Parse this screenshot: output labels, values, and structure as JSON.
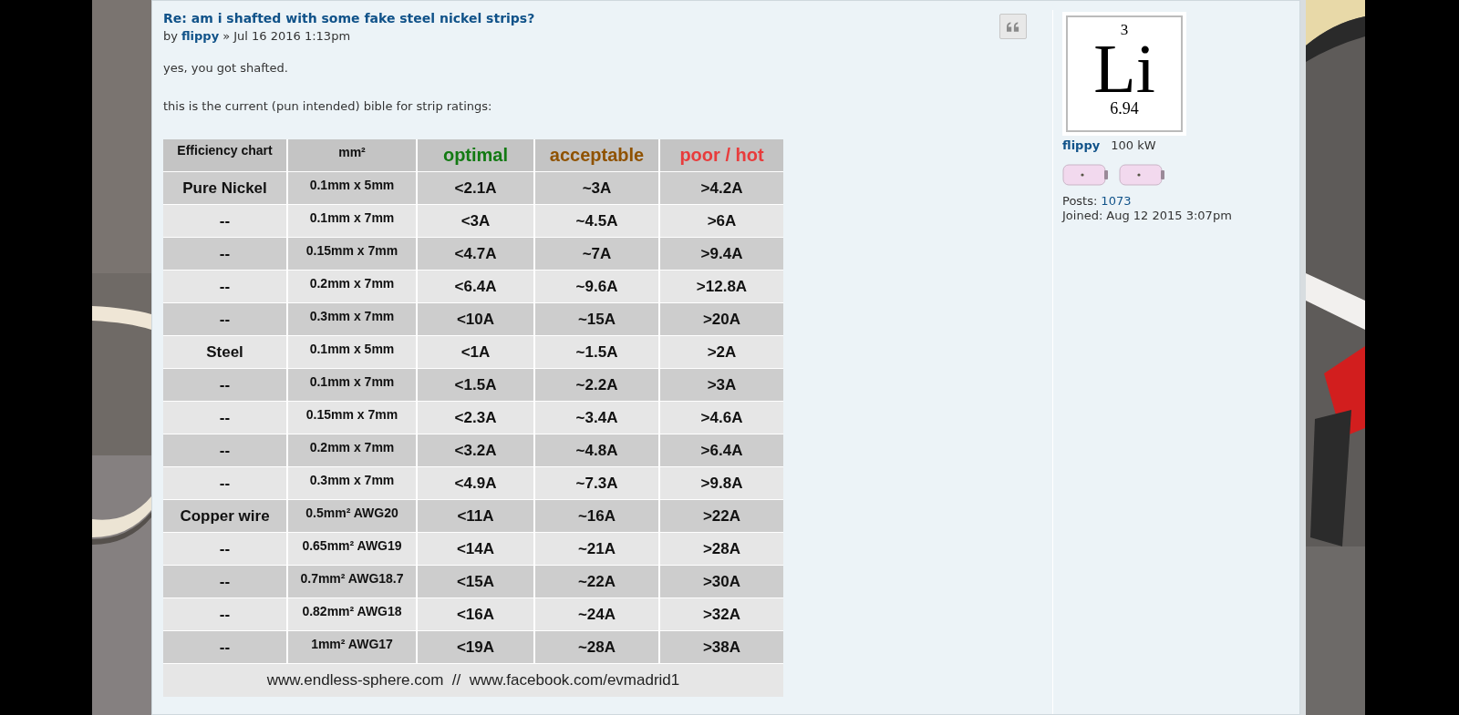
{
  "post": {
    "title": "Re: am i shafted with some fake steel nickel strips?",
    "byline": {
      "prefix": "by",
      "author": "flippy",
      "separator": "»",
      "date": "Jul 16 2016 1:13pm"
    },
    "paragraphs": [
      "yes, you got shafted.",
      "this is the current (pun intended) bible for strip ratings:"
    ],
    "table": {
      "columns": [
        {
          "label": "Efficiency chart"
        },
        {
          "label": "mm²"
        },
        {
          "label": "optimal",
          "color": "#137a13"
        },
        {
          "label": "acceptable",
          "color": "#8f5200"
        },
        {
          "label": "poor / hot",
          "color": "#e83c3c"
        }
      ],
      "rows": [
        {
          "cells": [
            "Pure Nickel",
            "0.1mm x 5mm",
            "<2.1A",
            "~3A",
            ">4.2A"
          ]
        },
        {
          "cells": [
            "--",
            "0.1mm x 7mm",
            "<3A",
            "~4.5A",
            ">6A"
          ]
        },
        {
          "cells": [
            "--",
            "0.15mm x 7mm",
            "<4.7A",
            "~7A",
            ">9.4A"
          ]
        },
        {
          "cells": [
            "--",
            "0.2mm x 7mm",
            "<6.4A",
            "~9.6A",
            ">12.8A"
          ]
        },
        {
          "cells": [
            "--",
            "0.3mm x 7mm",
            "<10A",
            "~15A",
            ">20A"
          ]
        },
        {
          "cells": [
            "Steel",
            "0.1mm x 5mm",
            "<1A",
            "~1.5A",
            ">2A"
          ]
        },
        {
          "cells": [
            "--",
            "0.1mm x 7mm",
            "<1.5A",
            "~2.2A",
            ">3A"
          ]
        },
        {
          "cells": [
            "--",
            "0.15mm x 7mm",
            "<2.3A",
            "~3.4A",
            ">4.6A"
          ]
        },
        {
          "cells": [
            "--",
            "0.2mm x 7mm",
            "<3.2A",
            "~4.8A",
            ">6.4A"
          ]
        },
        {
          "cells": [
            "--",
            "0.3mm x 7mm",
            "<4.9A",
            "~7.3A",
            ">9.8A"
          ]
        },
        {
          "cells": [
            "Copper wire",
            "0.5mm² AWG20",
            "<11A",
            "~16A",
            ">22A"
          ]
        },
        {
          "cells": [
            "--",
            "0.65mm² AWG19",
            "<14A",
            "~21A",
            ">28A"
          ]
        },
        {
          "cells": [
            "--",
            "0.7mm² AWG18.7",
            "<15A",
            "~22A",
            ">30A"
          ]
        },
        {
          "cells": [
            "--",
            "0.82mm² AWG18",
            "<16A",
            "~24A",
            ">32A"
          ]
        },
        {
          "cells": [
            "--",
            "1mm² AWG17",
            "<19A",
            "~28A",
            ">38A"
          ]
        }
      ],
      "footer": "www.endless-sphere.com  //  www.facebook.com/evmadrid1"
    }
  },
  "profile": {
    "avatar": {
      "number": "3",
      "symbol": "Li",
      "mass": "6.94"
    },
    "username": "flippy",
    "rank": "100 kW",
    "stats": [
      {
        "label": "Posts:",
        "value": "1073"
      },
      {
        "label": "Joined:",
        "value": "Aug 12 2015 3:07pm"
      }
    ]
  }
}
